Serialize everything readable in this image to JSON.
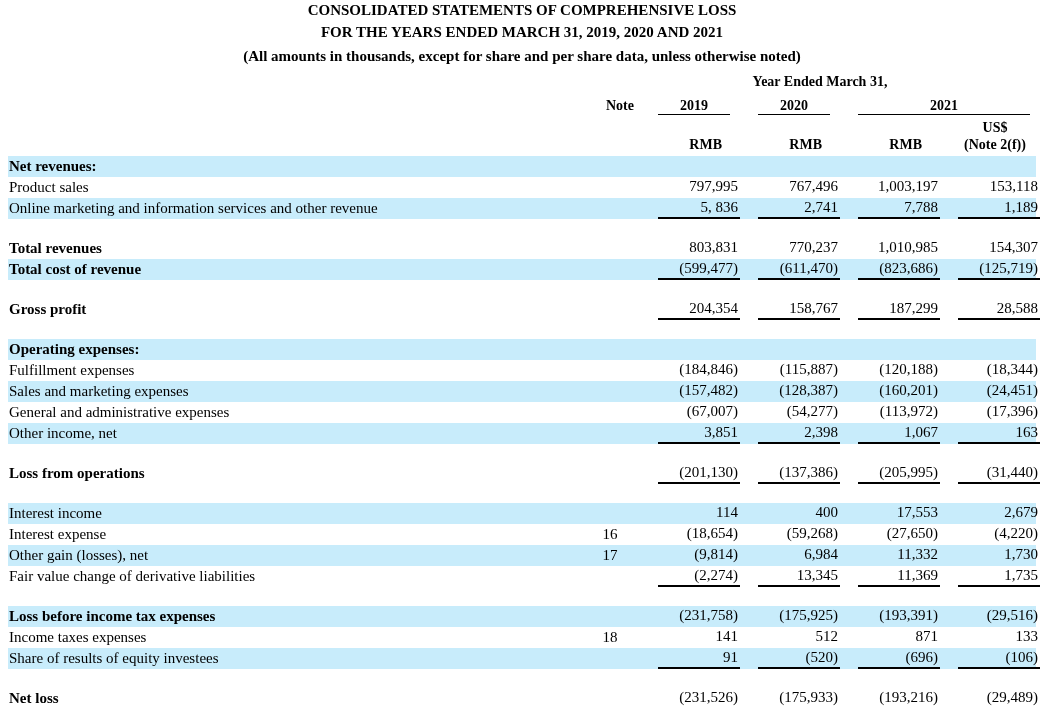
{
  "title_lines": [
    "CONSOLIDATED STATEMENTS OF COMPREHENSIVE LOSS",
    "FOR THE YEARS ENDED MARCH 31, 2019, 2020 AND 2021",
    "(All amounts in thousands, except for share and per share data, unless otherwise noted)"
  ],
  "header": {
    "group_label": "Year Ended March 31,",
    "note_label": "Note",
    "years": [
      "2019",
      "2020",
      "2021"
    ],
    "currencies": [
      {
        "label": "RMB"
      },
      {
        "label": "RMB"
      },
      {
        "label": "RMB"
      },
      {
        "label": "US$",
        "sublabel": "(Note 2(f))"
      }
    ]
  },
  "rows": [
    {
      "kind": "line",
      "label": "Net revenues:",
      "bold": true,
      "shaded": true
    },
    {
      "kind": "line",
      "label": "Product sales",
      "bold": false,
      "shaded": false,
      "rule": false,
      "values": [
        "797,995",
        "767,496",
        "1,003,197",
        "153,118"
      ]
    },
    {
      "kind": "line",
      "label": "Online marketing and information services and other revenue",
      "bold": false,
      "shaded": true,
      "rule": true,
      "values": [
        "5, 836",
        "2,741",
        "7,788",
        "1,189"
      ]
    },
    {
      "kind": "spacer"
    },
    {
      "kind": "line",
      "label": "Total revenues",
      "bold": true,
      "shaded": false,
      "rule": false,
      "values": [
        "803,831",
        "770,237",
        "1,010,985",
        "154,307"
      ]
    },
    {
      "kind": "line",
      "label": "Total cost of revenue",
      "bold": true,
      "shaded": true,
      "rule": true,
      "values": [
        "(599,477)",
        "(611,470)",
        "(823,686)",
        "(125,719)"
      ]
    },
    {
      "kind": "spacer"
    },
    {
      "kind": "line",
      "label": "Gross profit",
      "bold": true,
      "shaded": false,
      "rule": true,
      "values": [
        "204,354",
        "158,767",
        "187,299",
        "28,588"
      ]
    },
    {
      "kind": "spacer"
    },
    {
      "kind": "line",
      "label": "Operating expenses:",
      "bold": true,
      "shaded": true
    },
    {
      "kind": "line",
      "label": "Fulfillment expenses",
      "bold": false,
      "shaded": false,
      "rule": false,
      "values": [
        "(184,846)",
        "(115,887)",
        "(120,188)",
        "(18,344)"
      ]
    },
    {
      "kind": "line",
      "label": "Sales and marketing expenses",
      "bold": false,
      "shaded": true,
      "rule": false,
      "values": [
        "(157,482)",
        "(128,387)",
        "(160,201)",
        "(24,451)"
      ]
    },
    {
      "kind": "line",
      "label": "General and administrative expenses",
      "bold": false,
      "shaded": false,
      "rule": false,
      "values": [
        "(67,007)",
        "(54,277)",
        "(113,972)",
        "(17,396)"
      ]
    },
    {
      "kind": "line",
      "label": "Other income, net",
      "bold": false,
      "shaded": true,
      "rule": true,
      "values": [
        "3,851",
        "2,398",
        "1,067",
        "163"
      ]
    },
    {
      "kind": "spacer"
    },
    {
      "kind": "line",
      "label": "Loss from operations",
      "bold": true,
      "shaded": false,
      "rule": true,
      "values": [
        "(201,130)",
        "(137,386)",
        "(205,995)",
        "(31,440)"
      ]
    },
    {
      "kind": "spacer"
    },
    {
      "kind": "line",
      "label": "Interest income",
      "bold": false,
      "shaded": true,
      "rule": false,
      "values": [
        "114",
        "400",
        "17,553",
        "2,679"
      ]
    },
    {
      "kind": "line",
      "label": "Interest expense",
      "bold": false,
      "shaded": false,
      "rule": false,
      "note": "16",
      "values": [
        "(18,654)",
        "(59,268)",
        "(27,650)",
        "(4,220)"
      ]
    },
    {
      "kind": "line",
      "label": "Other gain (losses), net",
      "bold": false,
      "shaded": true,
      "rule": false,
      "note": "17",
      "values": [
        "(9,814)",
        "6,984",
        "11,332",
        "1,730"
      ]
    },
    {
      "kind": "line",
      "label": "Fair value change of derivative liabilities",
      "bold": false,
      "shaded": false,
      "rule": true,
      "values": [
        "(2,274)",
        "13,345",
        "11,369",
        "1,735"
      ]
    },
    {
      "kind": "spacer"
    },
    {
      "kind": "line",
      "label": "Loss before income tax expenses",
      "bold": true,
      "shaded": true,
      "rule": false,
      "values": [
        "(231,758)",
        "(175,925)",
        "(193,391)",
        "(29,516)"
      ]
    },
    {
      "kind": "line",
      "label": "Income taxes expenses",
      "bold": false,
      "shaded": false,
      "rule": false,
      "note": "18",
      "values": [
        "141",
        "512",
        "871",
        "133"
      ]
    },
    {
      "kind": "line",
      "label": "Share of results of equity investees",
      "bold": false,
      "shaded": true,
      "rule": true,
      "values": [
        "91",
        "(520)",
        "(696)",
        "(106)"
      ]
    },
    {
      "kind": "spacer"
    },
    {
      "kind": "line",
      "label": "Net loss",
      "bold": true,
      "shaded": false,
      "rule": false,
      "values": [
        "(231,526)",
        "(175,933)",
        "(193,216)",
        "(29,489)"
      ]
    }
  ]
}
